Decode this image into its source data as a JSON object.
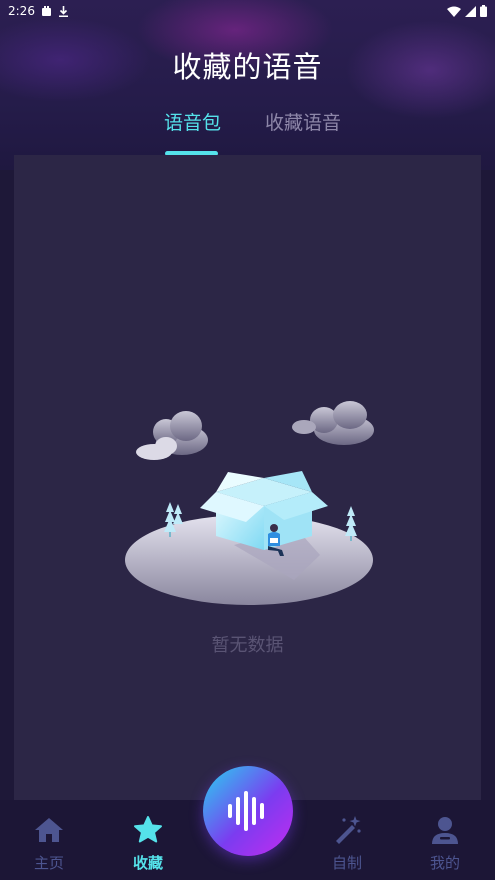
{
  "status_bar": {
    "time": "2:26"
  },
  "header": {
    "title": "收藏的语音"
  },
  "tabs": [
    {
      "label": "语音包",
      "active": true
    },
    {
      "label": "收藏语音",
      "active": false
    }
  ],
  "empty_state": {
    "text": "暂无数据"
  },
  "bottom_nav": {
    "items": [
      {
        "label": "主页",
        "icon": "home-icon",
        "active": false
      },
      {
        "label": "收藏",
        "icon": "star-icon",
        "active": true
      },
      {
        "label": "自制",
        "icon": "magic-wand-icon",
        "active": false
      },
      {
        "label": "我的",
        "icon": "user-icon",
        "active": false
      }
    ]
  },
  "colors": {
    "accent": "#55e2ea",
    "background": "#1e1838",
    "panel": "#2c2646",
    "inactive_nav": "#4d5590"
  }
}
